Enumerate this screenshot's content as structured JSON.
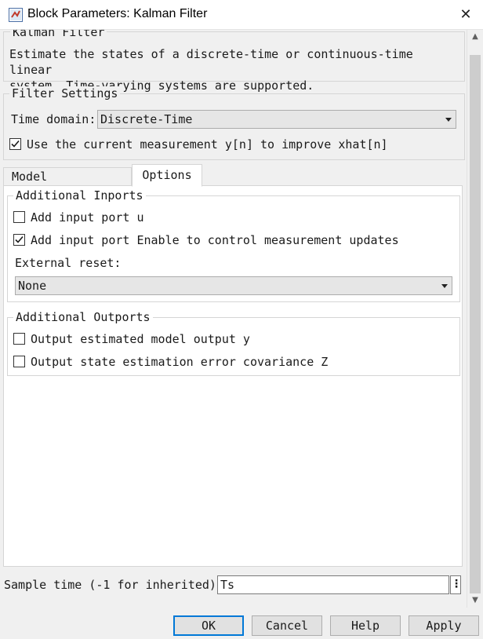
{
  "window": {
    "title": "Block Parameters: Kalman Filter",
    "close_glyph": "✕"
  },
  "description": {
    "title": "Kalman Filter",
    "text": "Estimate the states of a discrete-time or continuous-time linear\nsystem. Time-varying systems are supported."
  },
  "filter_settings": {
    "title": "Filter Settings",
    "time_domain_label": "Time domain:",
    "time_domain_value": "Discrete-Time",
    "use_current_label": "Use the current measurement y[n] to improve xhat[n]",
    "use_current_checked": true
  },
  "tabs": [
    {
      "label": "Model Parameters",
      "active": false
    },
    {
      "label": "Options",
      "active": true
    }
  ],
  "additional_inports": {
    "title": "Additional Inports",
    "add_input_u_label": "Add input port u",
    "add_input_u_checked": false,
    "add_enable_label": "Add input port Enable to control measurement updates",
    "add_enable_checked": true,
    "external_reset_label": "External reset:",
    "external_reset_value": "None"
  },
  "additional_outports": {
    "title": "Additional Outports",
    "output_y_label": "Output estimated model output y",
    "output_y_checked": false,
    "output_z_label": "Output state estimation error covariance Z",
    "output_z_checked": false
  },
  "sample_time": {
    "label": "Sample time (-1 for inherited):",
    "value": "Ts",
    "menu_glyph": "⋮"
  },
  "buttons": {
    "ok": "OK",
    "cancel": "Cancel",
    "help": "Help",
    "apply": "Apply"
  },
  "scrollbar": {
    "up_glyph": "▲",
    "down_glyph": "▼"
  },
  "colors": {
    "accent": "#0078d7",
    "dialog_bg": "#f0f0f0",
    "panel_bg": "#ffffff",
    "combo_bg": "#e6e6e6"
  }
}
